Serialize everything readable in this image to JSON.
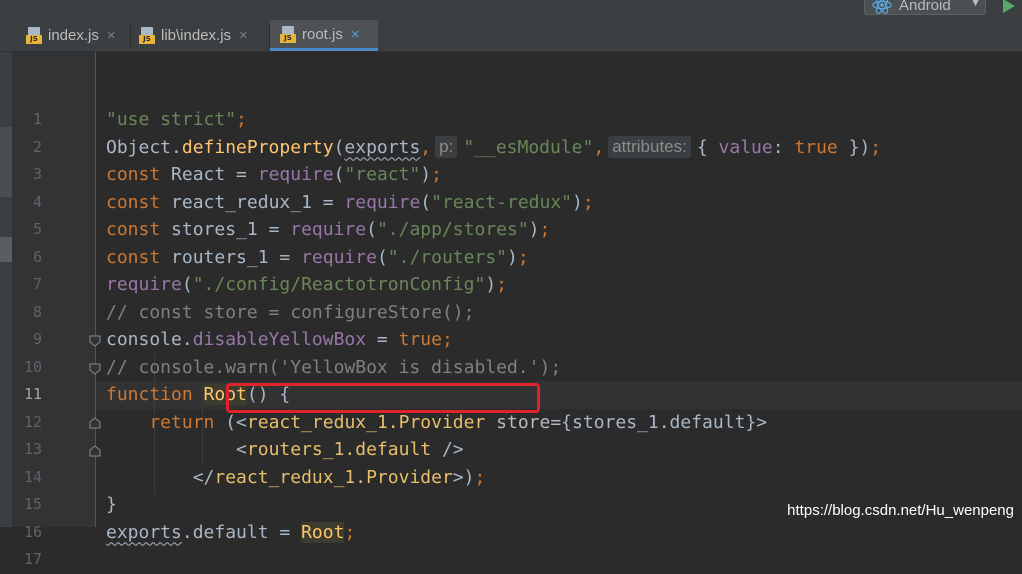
{
  "run_config": {
    "label": "Android",
    "icon": "react-icon"
  },
  "tabs": [
    {
      "label": "index.js",
      "active": false
    },
    {
      "label": "lib\\index.js",
      "active": false
    },
    {
      "label": "root.js",
      "active": true
    }
  ],
  "editor": {
    "current_line": 11,
    "lines": [
      {
        "num": "1",
        "tokens": [
          {
            "t": "\"use strict\"",
            "c": "#6a8759"
          },
          {
            "t": ";",
            "c": "#cc7832"
          }
        ]
      },
      {
        "num": "2",
        "tokens": [
          {
            "t": "Object.",
            "c": "#a9b7c6"
          },
          {
            "t": "defineProperty",
            "c": "#ffc66d"
          },
          {
            "t": "(",
            "c": "#a9b7c6"
          },
          {
            "t": "exports",
            "c": "#a9b7c6",
            "squiggle": true
          },
          {
            "t": ",",
            "c": "#cc7832"
          },
          {
            "hint": "p:"
          },
          {
            "t": "\"__esModule\"",
            "c": "#6a8759"
          },
          {
            "t": ",",
            "c": "#cc7832"
          },
          {
            "hint": "attributes:"
          },
          {
            "t": "{ ",
            "c": "#a9b7c6"
          },
          {
            "t": "value",
            "c": "#9876aa"
          },
          {
            "t": ": ",
            "c": "#a9b7c6"
          },
          {
            "t": "true",
            "c": "#cc7832"
          },
          {
            "t": " })",
            "c": "#a9b7c6"
          },
          {
            "t": ";",
            "c": "#cc7832"
          }
        ]
      },
      {
        "num": "3",
        "tokens": [
          {
            "t": "const ",
            "c": "#cc7832"
          },
          {
            "t": "React = ",
            "c": "#a9b7c6"
          },
          {
            "t": "require",
            "c": "#9876aa"
          },
          {
            "t": "(",
            "c": "#a9b7c6"
          },
          {
            "t": "\"react\"",
            "c": "#6a8759"
          },
          {
            "t": ")",
            "c": "#a9b7c6"
          },
          {
            "t": ";",
            "c": "#cc7832"
          }
        ]
      },
      {
        "num": "4",
        "tokens": [
          {
            "t": "const ",
            "c": "#cc7832"
          },
          {
            "t": "react_redux_1 = ",
            "c": "#a9b7c6"
          },
          {
            "t": "require",
            "c": "#9876aa"
          },
          {
            "t": "(",
            "c": "#a9b7c6"
          },
          {
            "t": "\"react-redux\"",
            "c": "#6a8759"
          },
          {
            "t": ")",
            "c": "#a9b7c6"
          },
          {
            "t": ";",
            "c": "#cc7832"
          }
        ]
      },
      {
        "num": "5",
        "tokens": [
          {
            "t": "const ",
            "c": "#cc7832"
          },
          {
            "t": "stores_1 = ",
            "c": "#a9b7c6"
          },
          {
            "t": "require",
            "c": "#9876aa"
          },
          {
            "t": "(",
            "c": "#a9b7c6"
          },
          {
            "t": "\"./app/stores\"",
            "c": "#6a8759"
          },
          {
            "t": ")",
            "c": "#a9b7c6"
          },
          {
            "t": ";",
            "c": "#cc7832"
          }
        ]
      },
      {
        "num": "6",
        "tokens": [
          {
            "t": "const ",
            "c": "#cc7832"
          },
          {
            "t": "routers_1 = ",
            "c": "#a9b7c6"
          },
          {
            "t": "require",
            "c": "#9876aa"
          },
          {
            "t": "(",
            "c": "#a9b7c6"
          },
          {
            "t": "\"./routers\"",
            "c": "#6a8759"
          },
          {
            "t": ")",
            "c": "#a9b7c6"
          },
          {
            "t": ";",
            "c": "#cc7832"
          }
        ]
      },
      {
        "num": "7",
        "tokens": [
          {
            "t": "require",
            "c": "#9876aa"
          },
          {
            "t": "(",
            "c": "#a9b7c6"
          },
          {
            "t": "\"./config/ReactotronConfig\"",
            "c": "#6a8759"
          },
          {
            "t": ")",
            "c": "#a9b7c6"
          },
          {
            "t": ";",
            "c": "#cc7832"
          }
        ]
      },
      {
        "num": "8",
        "tokens": [
          {
            "t": "// const store = configureStore();",
            "c": "#808080"
          }
        ]
      },
      {
        "num": "9",
        "tokens": [
          {
            "t": "console.",
            "c": "#a9b7c6"
          },
          {
            "t": "disableYellowBox",
            "c": "#9876aa"
          },
          {
            "t": " = ",
            "c": "#a9b7c6"
          },
          {
            "t": "true",
            "c": "#cc7832"
          },
          {
            "t": ";",
            "c": "#cc7832"
          }
        ]
      },
      {
        "num": "10",
        "tokens": [
          {
            "t": "// console.warn('YellowBox is disabled.');",
            "c": "#808080"
          }
        ]
      },
      {
        "num": "11",
        "tokens": [
          {
            "t": "function ",
            "c": "#cc7832"
          },
          {
            "t": "Root",
            "c": "#ffc66d",
            "bg": "#3b3b2e"
          },
          {
            "t": "() {",
            "c": "#a9b7c6"
          }
        ]
      },
      {
        "num": "12",
        "tokens": [
          {
            "t": "    return ",
            "c": "#cc7832"
          },
          {
            "t": "(<",
            "c": "#a9b7c6"
          },
          {
            "t": "react_redux_1.Provider ",
            "c": "#e8bf6a"
          },
          {
            "t": "store",
            "c": "#bababa"
          },
          {
            "t": "={stores_1.default}>",
            "c": "#a9b7c6"
          }
        ]
      },
      {
        "num": "13",
        "tokens": [
          {
            "t": "            <",
            "c": "#a9b7c6"
          },
          {
            "t": "routers_1.default ",
            "c": "#e8bf6a"
          },
          {
            "t": "/>",
            "c": "#a9b7c6"
          }
        ]
      },
      {
        "num": "14",
        "tokens": [
          {
            "t": "        </",
            "c": "#a9b7c6"
          },
          {
            "t": "react_redux_1.Provider",
            "c": "#e8bf6a"
          },
          {
            "t": ">)",
            "c": "#a9b7c6"
          },
          {
            "t": ";",
            "c": "#cc7832"
          }
        ]
      },
      {
        "num": "15",
        "tokens": [
          {
            "t": "}",
            "c": "#a9b7c6"
          }
        ]
      },
      {
        "num": "16",
        "tokens": [
          {
            "t": "exports",
            "c": "#a9b7c6",
            "squiggle": true
          },
          {
            "t": ".default = ",
            "c": "#a9b7c6"
          },
          {
            "t": "Root",
            "c": "#ffc66d",
            "bg": "#3b3b2e"
          },
          {
            "t": ";",
            "c": "#cc7832"
          }
        ]
      },
      {
        "num": "17",
        "tokens": []
      }
    ]
  },
  "watermark": "https://blog.csdn.net/Hu_wenpeng",
  "colors": {
    "background": "#2b2b2b",
    "keyword": "#cc7832",
    "string": "#6a8759",
    "function": "#ffc66d",
    "property": "#9876aa",
    "comment": "#808080",
    "jsx_tag": "#e8bf6a",
    "highlight_box": "#e0232b"
  }
}
